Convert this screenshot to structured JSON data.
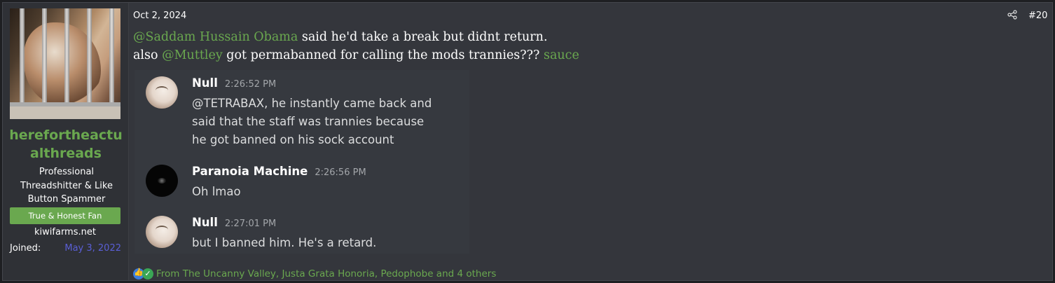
{
  "user": {
    "username_line1": "herefortheactu",
    "username_line2": "althreads",
    "title_lines": [
      "Professional",
      "Threadshitter & Like",
      "Button Spammer"
    ],
    "banner": "True & Honest Fan",
    "site": "kiwifarms.net",
    "joined_label": "Joined:",
    "joined_date": "May 3, 2022",
    "avatar_icon": "caged-dog-avatar"
  },
  "post": {
    "date": "Oct 2, 2024",
    "number": "#20",
    "share_icon": "share-icon",
    "line1": {
      "mention": "@Saddam Hussain Obama",
      "text": " said he'd take a break but didnt return."
    },
    "line2": {
      "prefix": "also ",
      "mention": "@Muttley",
      "text": " got permabanned for calling the mods trannies??? ",
      "link": "sauce"
    }
  },
  "screenshot": {
    "messages": [
      {
        "author": "Null",
        "time": "2:26:52 PM",
        "avatar": "null-avatar",
        "lines": [
          "@TETRABAX, he instantly came back and",
          "said that the staff was trannies because",
          "he got banned on his sock account"
        ]
      },
      {
        "author": "Paranoia Machine",
        "time": "2:26:56 PM",
        "avatar": "eye-avatar",
        "lines": [
          "Oh lmao"
        ]
      },
      {
        "author": "Null",
        "time": "2:27:01 PM",
        "avatar": "null-avatar",
        "lines": [
          "but I banned him. He's a retard."
        ]
      }
    ]
  },
  "reactions": {
    "icons": [
      "like-icon",
      "check-icon"
    ],
    "text": "From The Uncanny Valley, Justa Grata Honoria, Pedophobe and 4 others"
  }
}
